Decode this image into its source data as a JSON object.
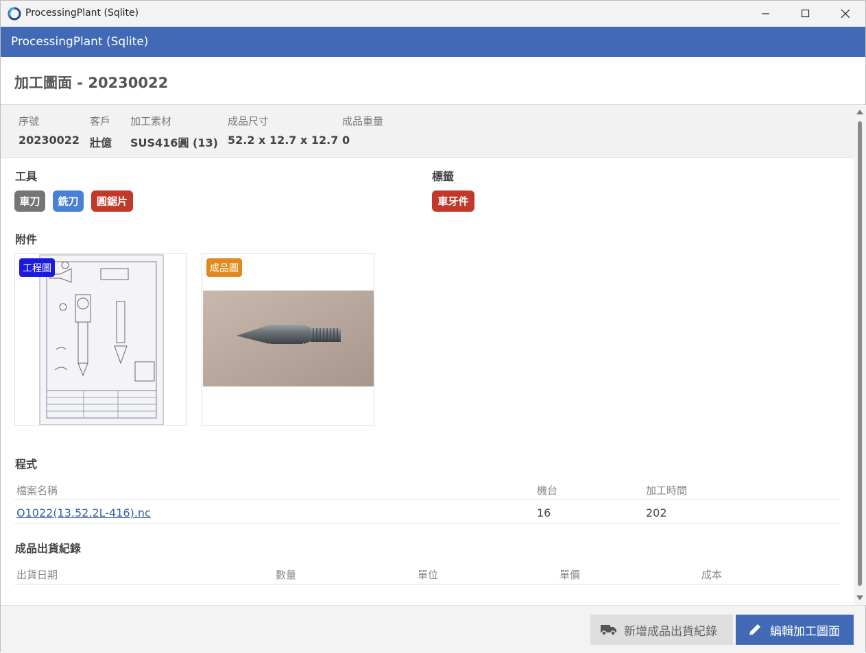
{
  "window": {
    "title": "ProcessingPlant (Sqlite)"
  },
  "header": {
    "title": "ProcessingPlant (Sqlite)"
  },
  "page": {
    "title": "加工圖面 - 20230022"
  },
  "info": [
    {
      "label": "序號",
      "value": "20230022"
    },
    {
      "label": "客戶",
      "value": "壯億"
    },
    {
      "label": "加工素材",
      "value": "SUS416圓 (13)"
    },
    {
      "label": "成品尺寸",
      "value": "52.2 x 12.7 x 12.7"
    },
    {
      "label": "成品重量",
      "value": "0"
    }
  ],
  "tools": {
    "title": "工具",
    "items": [
      {
        "label": "車刀",
        "color": "#757575"
      },
      {
        "label": "銑刀",
        "color": "#4a7fd6"
      },
      {
        "label": "圓鋸片",
        "color": "#c0392b"
      }
    ]
  },
  "tags": {
    "title": "標籤",
    "items": [
      {
        "label": "車牙件",
        "color": "#c0392b"
      }
    ]
  },
  "attachments": {
    "title": "附件",
    "items": [
      {
        "tag": "工程圖",
        "color": "#1a1ae0"
      },
      {
        "tag": "成品圖",
        "color": "#e08a1e"
      }
    ]
  },
  "program": {
    "title": "程式",
    "columns": [
      "檔案名稱",
      "機台",
      "加工時間"
    ],
    "rows": [
      {
        "file": "O1022(13.52.2L-416).nc",
        "machine": "16",
        "time": "202"
      }
    ]
  },
  "shipping": {
    "title": "成品出貨紀錄",
    "columns": [
      "出貨日期",
      "數量",
      "單位",
      "單價",
      "成本"
    ]
  },
  "footer": {
    "add_shipment": "新增成品出貨紀錄",
    "edit_drawing": "編輯加工圖面"
  }
}
